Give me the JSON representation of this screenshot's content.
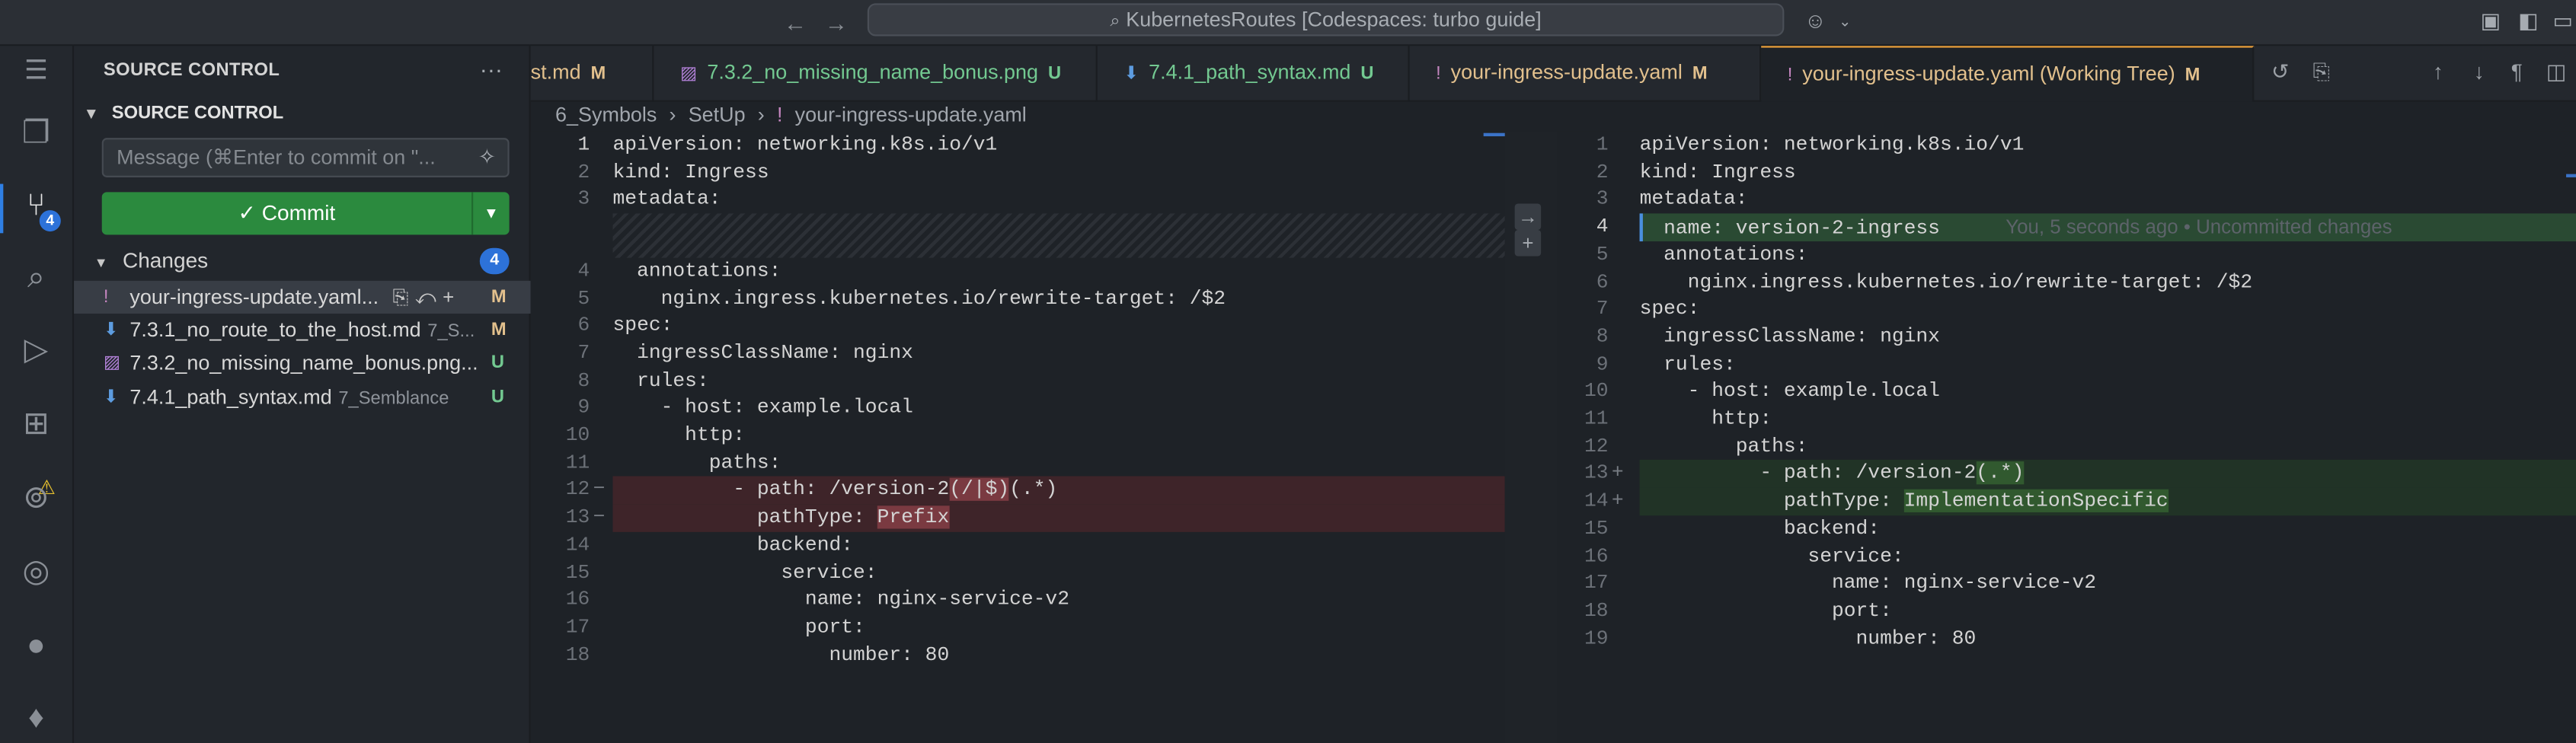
{
  "titlebar": {
    "back_icon": "←",
    "forward_icon": "→",
    "command_center": "KubernetesRoutes [Codespaces: turbo guide]",
    "copilot_icon": "copilot-icon"
  },
  "activity": {
    "scm_badge": "4"
  },
  "sidebar": {
    "title": "SOURCE CONTROL",
    "more": "···",
    "section": "SOURCE CONTROL",
    "message_placeholder": "Message (⌘Enter to commit on \"...",
    "commit_label": "✓ Commit",
    "changes_label": "Changes",
    "changes_count": "4",
    "files": [
      {
        "icon": "!",
        "name": "your-ingress-update.yaml...",
        "dir": "",
        "status": "M",
        "icon_color": "#c586c0",
        "status_color": "#e2c08d"
      },
      {
        "icon": "⬇",
        "name": "7.3.1_no_route_to_the_host.md",
        "dir": "7_S...",
        "status": "M",
        "icon_color": "#5d9ce0",
        "status_color": "#e2c08d"
      },
      {
        "icon": "▨",
        "name": "7.3.2_no_missing_name_bonus.png...",
        "dir": "",
        "status": "U",
        "icon_color": "#b180d7",
        "status_color": "#73c991"
      },
      {
        "icon": "⬇",
        "name": "7.4.1_path_syntax.md",
        "dir": "7_Semblance",
        "status": "U",
        "icon_color": "#5d9ce0",
        "status_color": "#73c991"
      }
    ]
  },
  "tabs": [
    {
      "icon": "",
      "label": "st.md",
      "status": "M",
      "label_color": "#e2c08d",
      "active": false
    },
    {
      "icon": "▨",
      "label": "7.3.2_no_missing_name_bonus.png",
      "status": "U",
      "label_color": "#73c991",
      "active": false
    },
    {
      "icon": "⬇",
      "label": "7.4.1_path_syntax.md",
      "status": "U",
      "label_color": "#73c991",
      "active": false
    },
    {
      "icon": "!",
      "label": "your-ingress-update.yaml",
      "status": "M",
      "label_color": "#e2c08d",
      "active": false
    },
    {
      "icon": "!",
      "label": "your-ingress-update.yaml (Working Tree)",
      "status": "M",
      "label_color": "#e2c08d",
      "active": true
    }
  ],
  "breadcrumbs": [
    "6_Symbols",
    "SetUp",
    "your-ingress-update.yaml"
  ],
  "left_pane": [
    {
      "n": "1",
      "text": "apiVersion: networking.k8s.io/v1"
    },
    {
      "n": "2",
      "text": "kind: Ingress"
    },
    {
      "n": "3",
      "text": "metadata:"
    },
    {
      "n": "4",
      "text": "  annotations:"
    },
    {
      "n": "5",
      "text": "    nginx.ingress.kubernetes.io/rewrite-target: /$2"
    },
    {
      "n": "6",
      "text": "spec:"
    },
    {
      "n": "7",
      "text": "  ingressClassName: nginx"
    },
    {
      "n": "8",
      "text": "  rules:"
    },
    {
      "n": "9",
      "text": "    - host: example.local"
    },
    {
      "n": "10",
      "text": "      http:"
    },
    {
      "n": "11",
      "text": "        paths:"
    },
    {
      "n": "12",
      "text": "          - path: /version-2",
      "hl": "(/|$)",
      "after": "(.*)"
    },
    {
      "n": "13",
      "text": "            pathType: ",
      "hl": "Prefix",
      "after": ""
    },
    {
      "n": "14",
      "text": "            backend:"
    },
    {
      "n": "15",
      "text": "              service:"
    },
    {
      "n": "16",
      "text": "                name: nginx-service-v2"
    },
    {
      "n": "17",
      "text": "                port:"
    },
    {
      "n": "18",
      "text": "                  number: 80"
    }
  ],
  "right_pane": [
    {
      "n": "1",
      "text": "apiVersion: networking.k8s.io/v1"
    },
    {
      "n": "2",
      "text": "kind: Ingress"
    },
    {
      "n": "3",
      "text": "metadata:"
    },
    {
      "n": "4",
      "text": "  name: version-2-ingress",
      "blame": "You, 5 seconds ago • Uncommitted changes"
    },
    {
      "n": "5",
      "text": "  annotations:"
    },
    {
      "n": "6",
      "text": "    nginx.ingress.kubernetes.io/rewrite-target: /$2"
    },
    {
      "n": "7",
      "text": "spec:"
    },
    {
      "n": "8",
      "text": "  ingressClassName: nginx"
    },
    {
      "n": "9",
      "text": "  rules:"
    },
    {
      "n": "10",
      "text": "    - host: example.local"
    },
    {
      "n": "11",
      "text": "      http:"
    },
    {
      "n": "12",
      "text": "        paths:"
    },
    {
      "n": "13",
      "text": "          - path: /version-2",
      "hl": "",
      "after": "(.*)"
    },
    {
      "n": "14",
      "text": "            pathType: ",
      "hl": "ImplementationSpecific",
      "after": ""
    },
    {
      "n": "15",
      "text": "            backend:"
    },
    {
      "n": "16",
      "text": "              service:"
    },
    {
      "n": "17",
      "text": "                name: nginx-service-v2"
    },
    {
      "n": "18",
      "text": "                port:"
    },
    {
      "n": "19",
      "text": "                  number: 80"
    }
  ],
  "gap_buttons": [
    "→",
    "+"
  ]
}
